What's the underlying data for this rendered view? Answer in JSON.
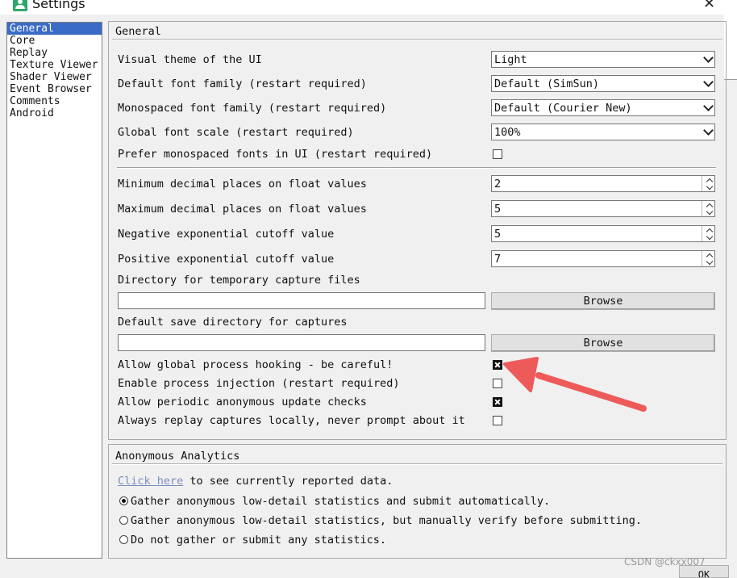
{
  "window": {
    "title": "Settings",
    "close_glyph": "✕"
  },
  "sidebar": {
    "items": [
      {
        "label": "General",
        "selected": true
      },
      {
        "label": "Core"
      },
      {
        "label": "Replay"
      },
      {
        "label": "Texture Viewer"
      },
      {
        "label": "Shader Viewer"
      },
      {
        "label": "Event Browser"
      },
      {
        "label": "Comments"
      },
      {
        "label": "Android"
      }
    ]
  },
  "general": {
    "title": "General",
    "theme": {
      "label": "Visual theme of the UI",
      "value": "Light"
    },
    "font_family": {
      "label": "Default font family (restart required)",
      "value": "Default (SimSun)"
    },
    "mono_family": {
      "label": "Monospaced font family (restart required)",
      "value": "Default (Courier New)"
    },
    "font_scale": {
      "label": "Global font scale (restart required)",
      "value": "100%"
    },
    "prefer_mono": {
      "label": "Prefer monospaced fonts in UI (restart required)",
      "checked": false
    },
    "min_decimal": {
      "label": "Minimum decimal places on float values",
      "value": "2"
    },
    "max_decimal": {
      "label": "Maximum decimal places on float values",
      "value": "5"
    },
    "neg_exp": {
      "label": "Negative exponential cutoff value",
      "value": "5"
    },
    "pos_exp": {
      "label": "Positive exponential cutoff value",
      "value": "7"
    },
    "temp_dir": {
      "label": "Directory for temporary capture files",
      "value": "",
      "browse": "Browse"
    },
    "save_dir": {
      "label": "Default save directory for captures",
      "value": "",
      "browse": "Browse"
    },
    "global_hook": {
      "label": "Allow global process hooking - be careful!",
      "checked": true
    },
    "injection": {
      "label": "Enable process injection (restart required)",
      "checked": false
    },
    "update_checks": {
      "label": "Allow periodic anonymous update checks",
      "checked": true
    },
    "replay_local": {
      "label": "Always replay captures locally, never prompt about it",
      "checked": false
    }
  },
  "analytics": {
    "title": "Anonymous Analytics",
    "link": "Click here",
    "link_suffix": " to see currently reported data.",
    "options": [
      {
        "label": "Gather anonymous low-detail statistics and submit automatically.",
        "selected": true
      },
      {
        "label": "Gather anonymous low-detail statistics, but manually verify before submitting.",
        "selected": false
      },
      {
        "label": "Do not gather or submit any statistics.",
        "selected": false
      }
    ]
  },
  "footer": {
    "ok": "OK",
    "watermark": "CSDN @ckxx007"
  },
  "colors": {
    "selection": "#3a6bc6",
    "annotation_arrow": "#ee5a5a",
    "link": "#7a8fc0"
  }
}
